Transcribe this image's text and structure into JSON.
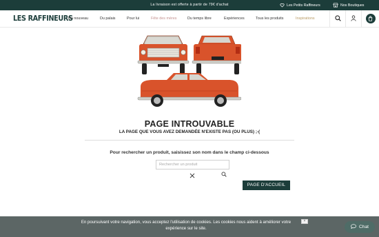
{
  "topbar": {
    "announcement": "La livraison est offerte à partir de 79€ d'achat",
    "links": [
      {
        "label": "Les Petits Raffineurs",
        "icon": "heart-hands-icon"
      },
      {
        "label": "Nos Boutiques",
        "icon": "store-icon"
      }
    ]
  },
  "header": {
    "logo": "LES RAFFINEURS",
    "nav": [
      {
        "label": "Du nouveau"
      },
      {
        "label": "Du palais"
      },
      {
        "label": "Pour lui"
      },
      {
        "label": "Fête des mères",
        "color": "#c4918f"
      },
      {
        "label": "Du temps libre"
      },
      {
        "label": "Expériences"
      },
      {
        "label": "Tous les produits"
      },
      {
        "label": "Inspirations",
        "color": "#b89a63"
      }
    ],
    "icons": [
      "search-icon",
      "account-icon",
      "cart-icon"
    ]
  },
  "main": {
    "title": "PAGE INTROUVABLE",
    "subtitle": "LA PAGE QUE VOUS AVEZ DEMANDÉE N'EXISTE PAS (OU PLUS) ;-(",
    "prompt": "Pour rechercher un produit, saisissez son nom dans le champ ci-dessous",
    "search": {
      "value": "",
      "placeholder": "Rechercher un produit"
    },
    "home_button": "PAGE D'ACCUEIL",
    "illustration": "vintage-orange-cars-illustration"
  },
  "cookie": {
    "text": "En poursuivant votre navigation, vous acceptez l'utilisation de cookies. Les cookies nous aident à améliorer votre expérience sur le site.",
    "close": "×"
  },
  "chat": {
    "label": "Chat",
    "icon": "chat-bubble-icon"
  },
  "colors": {
    "brand": "#1c3d3a",
    "highlight_pink": "#c4918f",
    "highlight_gold": "#b89a63",
    "car_orange": "#d9532b",
    "cookie_bg": "#5c6665",
    "chat_bg": "#4f6c67"
  }
}
